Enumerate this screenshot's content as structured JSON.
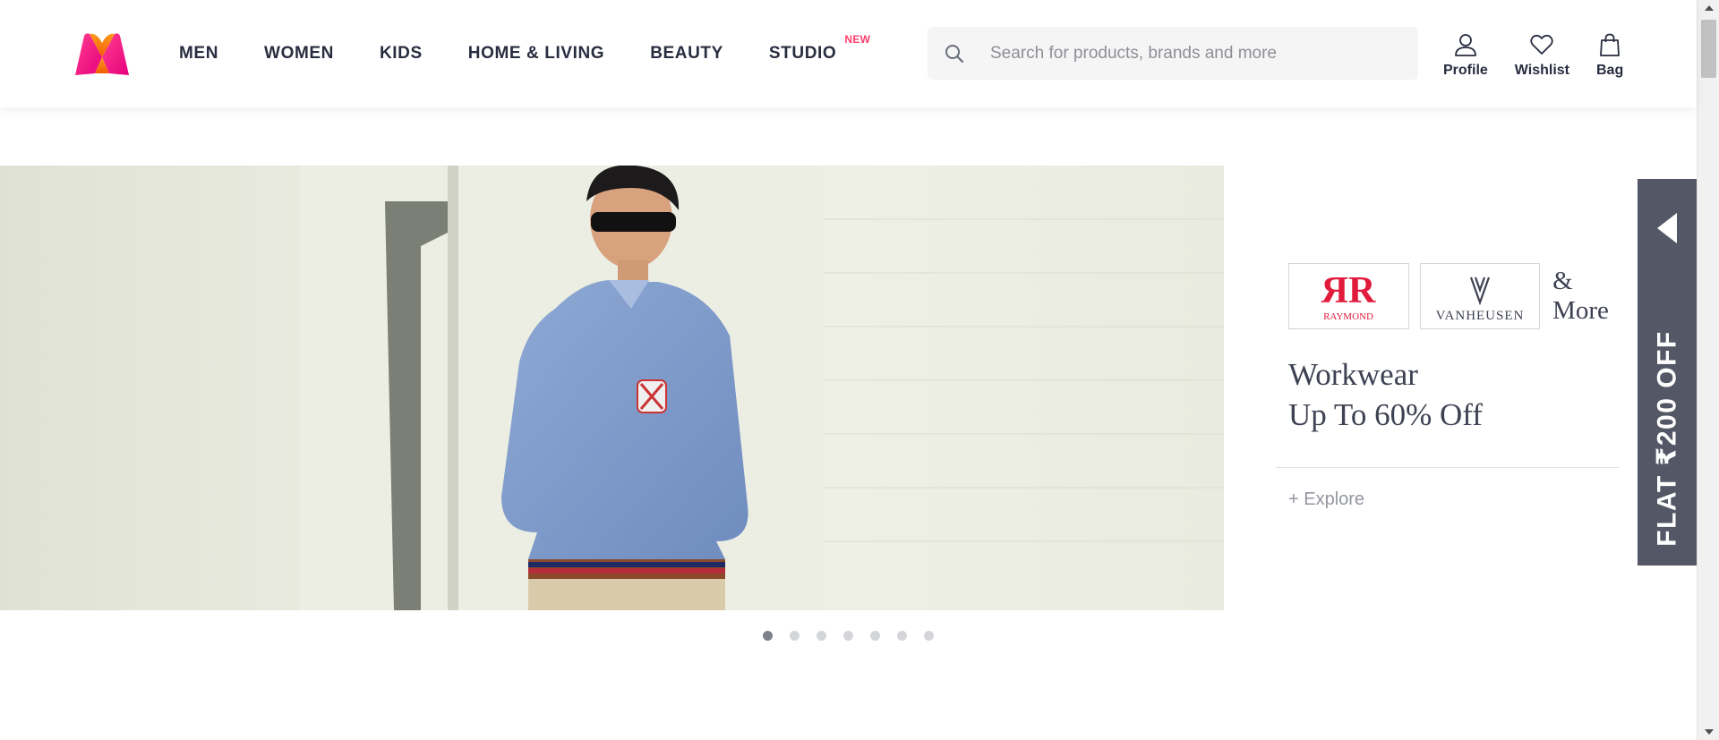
{
  "header": {
    "nav": [
      {
        "label": "MEN"
      },
      {
        "label": "WOMEN"
      },
      {
        "label": "KIDS"
      },
      {
        "label": "HOME & LIVING"
      },
      {
        "label": "BEAUTY"
      },
      {
        "label": "STUDIO",
        "tag": "NEW"
      }
    ],
    "search": {
      "placeholder": "Search for products, brands and more"
    },
    "actions": [
      {
        "label": "Profile",
        "icon": "profile-icon"
      },
      {
        "label": "Wishlist",
        "icon": "heart-icon"
      },
      {
        "label": "Bag",
        "icon": "bag-icon"
      }
    ]
  },
  "promo": {
    "brands": [
      {
        "name": "Raymond",
        "logo_text": "RAYMOND"
      },
      {
        "name": "Van Heusen",
        "logo_text": "VANHEUSEN"
      }
    ],
    "more": "& More",
    "headline_line1": "Workwear",
    "headline_line2": "Up To 60% Off",
    "explore": "+ Explore"
  },
  "side_tab": {
    "label": "FLAT ₹200 OFF"
  },
  "carousel": {
    "total_slides": 7,
    "active_slide": 1
  },
  "colors": {
    "brand_pink": "#ff3f6c",
    "text_dark": "#282c3f",
    "tab_bg": "#535766",
    "raymond_red": "#e11b3c"
  }
}
